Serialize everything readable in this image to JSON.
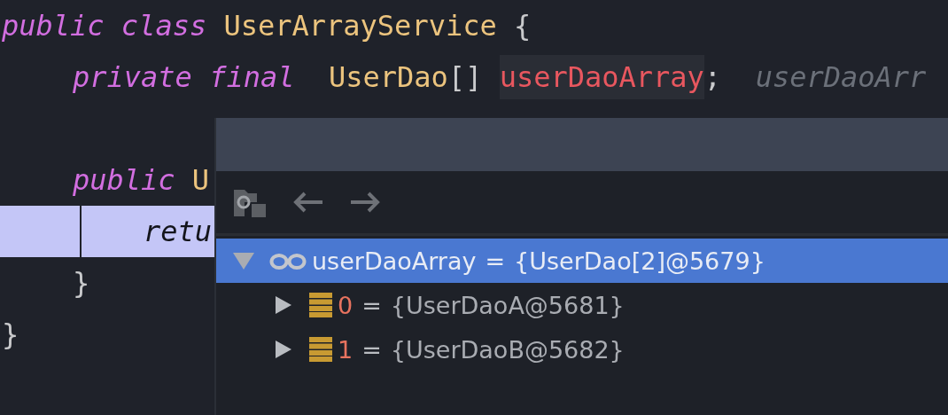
{
  "editor": {
    "lines": [
      {
        "kind": "code",
        "highlighted": false,
        "tokens": [
          {
            "text": "public class",
            "kind": "keyword"
          },
          {
            "text": " UserArrayService",
            "kind": "type"
          },
          {
            "text": " {",
            "kind": "plain"
          }
        ],
        "children": [
          {
            "kind": "code",
            "highlighted": false,
            "tokens": [
              {
                "text": "private final",
                "kind": "keyword"
              },
              {
                "text": "  UserDao",
                "kind": "type"
              },
              {
                "text": "[] ",
                "kind": "plain"
              },
              {
                "text": "userDaoArray",
                "kind": "field"
              },
              {
                "text": ";",
                "kind": "plain"
              },
              {
                "text": "  userDaoArr",
                "kind": "hint"
              }
            ]
          },
          {
            "kind": "blank",
            "highlighted": false
          },
          {
            "kind": "code",
            "highlighted": false,
            "tokens": [
              {
                "text": "public",
                "kind": "keyword"
              },
              {
                "text": " U",
                "kind": "type"
              }
            ],
            "children": [
              {
                "kind": "code",
                "highlighted": true,
                "tokens": [
                  {
                    "text": "retu",
                    "kind": "keyword"
                  }
                ]
              }
            ]
          },
          {
            "kind": "code",
            "highlighted": false,
            "tokens": [
              {
                "text": "}",
                "kind": "plain"
              }
            ]
          }
        ]
      },
      {
        "kind": "code",
        "highlighted": false,
        "tokens": [
          {
            "text": "}",
            "kind": "plain"
          }
        ]
      }
    ]
  },
  "popup": {
    "toolbar": [
      {
        "kind": "structure",
        "disabled": false
      },
      {
        "kind": "back",
        "disabled": true
      },
      {
        "kind": "forward",
        "disabled": true
      }
    ],
    "tree": [
      {
        "name": "userDaoArray",
        "equals": "=",
        "value": "{UserDao[2]@5679}",
        "kind": "watch",
        "expanded": true,
        "selected": true,
        "children": [
          {
            "name": "0",
            "equals": "=",
            "value": "{UserDaoA@5681}",
            "kind": "element",
            "expanded": false,
            "selected": false
          },
          {
            "name": "1",
            "equals": "=",
            "value": "{UserDaoB@5682}",
            "kind": "element",
            "expanded": false,
            "selected": false
          }
        ]
      }
    ]
  }
}
